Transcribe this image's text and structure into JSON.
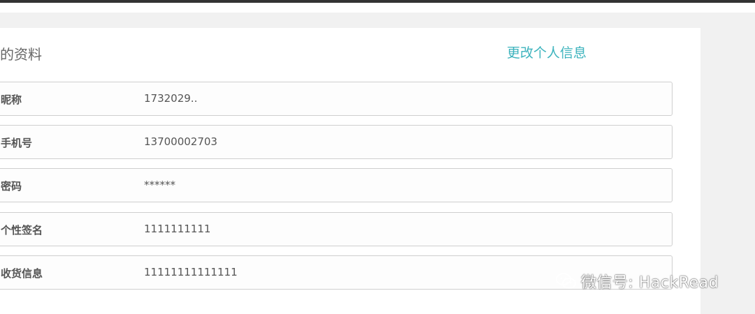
{
  "header": {},
  "profile": {
    "title": "的资料",
    "edit_link": "更改个人信息",
    "rows": [
      {
        "label": "昵称",
        "value": "1732029.."
      },
      {
        "label": "手机号",
        "value": "13700002703"
      },
      {
        "label": "密码",
        "value": "******"
      },
      {
        "label": "个性签名",
        "value": "1111111111"
      },
      {
        "label": "收货信息",
        "value": "11111111111111"
      }
    ]
  },
  "watermark": {
    "text": "微信号: HackRead",
    "icon": "wechat-icon"
  }
}
